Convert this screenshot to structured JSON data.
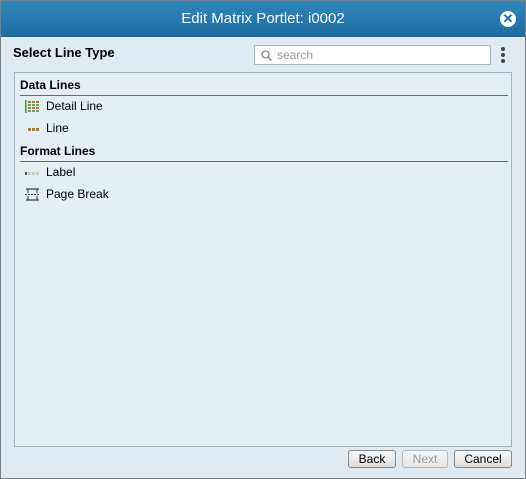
{
  "dialog": {
    "title": "Edit Matrix Portlet: i0002",
    "close_symbol": "✕"
  },
  "header": {
    "label": "Select Line Type",
    "search_placeholder": "search",
    "search_value": ""
  },
  "groups": [
    {
      "label": "Data Lines",
      "items": [
        {
          "label": "Detail Line",
          "icon": "detail-line-icon"
        },
        {
          "label": "Line",
          "icon": "line-icon"
        }
      ]
    },
    {
      "label": "Format Lines",
      "items": [
        {
          "label": "Label",
          "icon": "label-icon"
        },
        {
          "label": "Page Break",
          "icon": "page-break-icon"
        }
      ]
    }
  ],
  "buttons": {
    "back": "Back",
    "next": "Next",
    "cancel": "Cancel"
  },
  "colors": {
    "titlebar": "#1c6aa0",
    "panel_bg": "#e3eef5",
    "dialog_bg": "#dfeaf2"
  }
}
